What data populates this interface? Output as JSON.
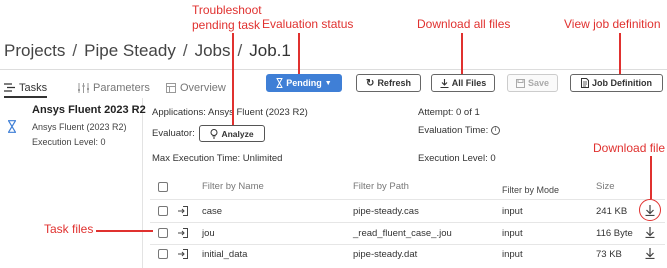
{
  "breadcrumb": [
    "Projects",
    "Pipe Steady",
    "Jobs",
    "Job.1"
  ],
  "breadcrumb_separator": "/",
  "tabs": [
    {
      "label": "Tasks",
      "icon": "tasks-icon"
    },
    {
      "label": "Parameters",
      "icon": "parameters-icon"
    },
    {
      "label": "Overview",
      "icon": "overview-icon"
    }
  ],
  "toolbar": {
    "status_label": "Pending",
    "refresh_label": "Refresh",
    "all_files_label": "All Files",
    "save_label": "Save",
    "job_definition_label": "Job Definition"
  },
  "task": {
    "name": "Ansys Fluent 2023 R2",
    "application": "Ansys Fluent (2023 R2)",
    "execution_level": "Execution Level: 0"
  },
  "details": {
    "applications": "Applications: Ansys Fluent (2023 R2)",
    "evaluator": "Evaluator:",
    "analyze_label": "Analyze",
    "max_execution_time": "Max Execution Time: Unlimited",
    "attempt": "Attempt: 0 of 1",
    "evaluation_time": "Evaluation Time:",
    "execution_level": "Execution Level: 0"
  },
  "files_table": {
    "headers": {
      "name": "Filter by Name",
      "path": "Filter by Path",
      "mode": "Filter by Mode",
      "size": "Size"
    },
    "rows": [
      {
        "name": "case",
        "path": "pipe-steady.cas",
        "mode": "input",
        "size": "241 KB"
      },
      {
        "name": "jou",
        "path": "_read_fluent_case_.jou",
        "mode": "input",
        "size": "116 Byte"
      },
      {
        "name": "initial_data",
        "path": "pipe-steady.dat",
        "mode": "input",
        "size": "73 KB"
      }
    ]
  },
  "callouts": {
    "troubleshoot": "Troubleshoot\npending task",
    "evaluation_status": "Evaluation status",
    "download_all": "Download all files",
    "view_job_definition": "View job definition",
    "download_file": "Download file",
    "task_files": "Task files"
  },
  "colors": {
    "accent": "#3f7fd6",
    "callout": "#e0312f",
    "status_icon": "#3f7fd6"
  }
}
